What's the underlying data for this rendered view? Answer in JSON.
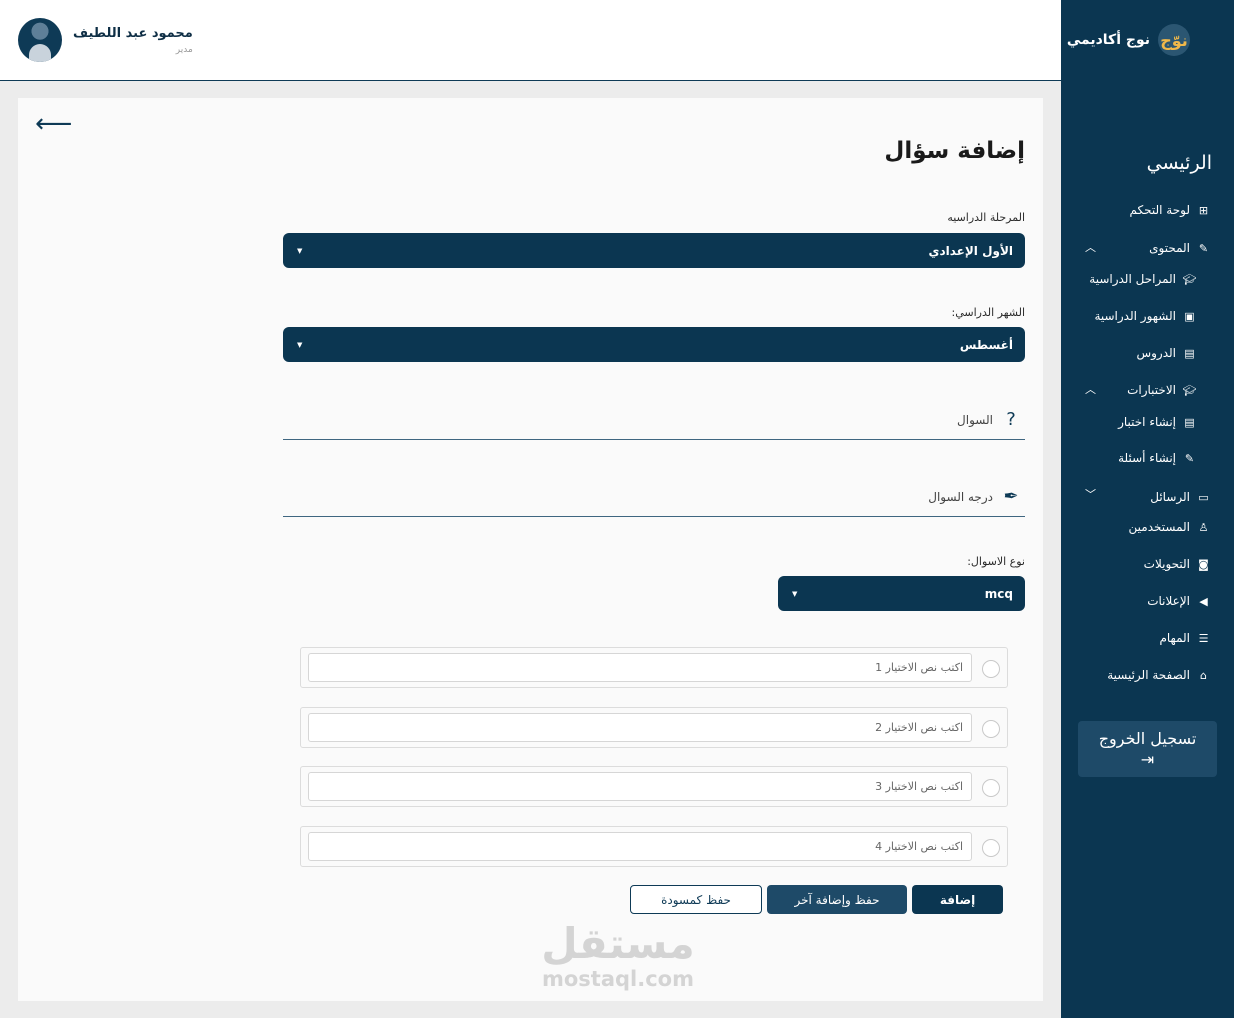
{
  "header": {
    "user_name": "محمود عبد اللطيف",
    "user_role": "مدير"
  },
  "sidebar": {
    "brand_logo": "نوّج",
    "brand_name": "نوج أكاديمي",
    "section_title": "الرئيسي",
    "items": {
      "dashboard": "لوحة التحكم",
      "content": "المحتوى",
      "stages": "المراحل الدراسية",
      "months": "الشهور الدراسية",
      "lessons": "الدروس",
      "exams": "الاختبارات",
      "create_exam": "إنشاء اختبار",
      "create_questions": "إنشاء أسئلة",
      "messages": "الرسائل",
      "users": "المستخدمين",
      "transfers": "التحويلات",
      "ads": "الإعلانات",
      "tasks": "المهام",
      "home": "الصفحة الرئيسية"
    },
    "logout_label": "تسجيل الخروج"
  },
  "form": {
    "title": "إضافة سؤال",
    "stage_label": "المرحلة الدراسيه",
    "stage_value": "الأول الإعدادي",
    "month_label": "الشهر الدراسي:",
    "month_value": "أغسطس",
    "question_placeholder": "السوال",
    "grade_placeholder": "درجه السوال",
    "type_label": "نوع الاسوال:",
    "type_value": "mcq",
    "options": [
      "اكتب نص الاختيار 1",
      "اكتب نص الاختيار 2",
      "اكتب نص الاختيار 3",
      "اكتب نص الاختيار 4"
    ],
    "buttons": {
      "add": "إضافة",
      "save_add_another": "حفظ وإضافة آخر",
      "save_draft": "حفظ كمسودة"
    }
  },
  "watermark": {
    "arabic": "مستقل",
    "latin": "mostaql.com"
  },
  "colors": {
    "primary": "#0b3651",
    "secondary": "#1e4a68",
    "background": "#ececec"
  }
}
